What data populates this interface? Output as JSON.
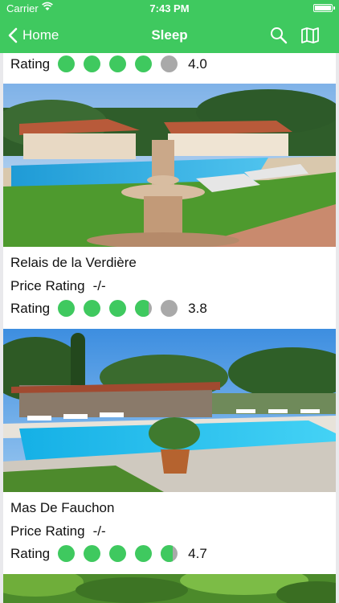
{
  "status_bar": {
    "carrier": "Carrier",
    "time": "7:43 PM"
  },
  "nav": {
    "back_label": "Home",
    "title": "Sleep",
    "search_icon": "search-icon",
    "map_icon": "map-icon"
  },
  "colors": {
    "accent": "#3fc95f",
    "empty_dot": "#a9a9a9"
  },
  "listings": [
    {
      "name": "",
      "price_label": "",
      "price_value": "",
      "rating_label": "Rating",
      "rating": "4.0",
      "rating_value": 4.0
    },
    {
      "name": "Relais de la Verdière",
      "price_label": "Price Rating",
      "price_value": "-/-",
      "rating_label": "Rating",
      "rating": "3.8",
      "rating_value": 3.8
    },
    {
      "name": "Mas De Fauchon",
      "price_label": "Price Rating",
      "price_value": "-/-",
      "rating_label": "Rating",
      "rating": "4.7",
      "rating_value": 4.7
    }
  ]
}
